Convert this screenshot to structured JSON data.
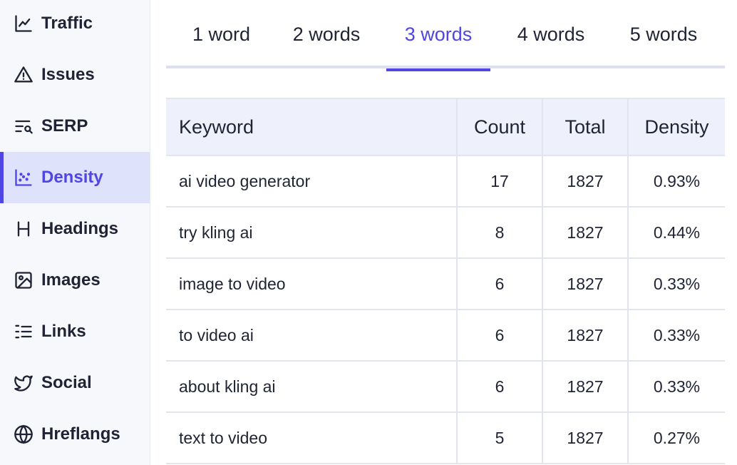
{
  "sidebar": {
    "items": [
      {
        "label": "Traffic",
        "icon": "chart-line-icon"
      },
      {
        "label": "Issues",
        "icon": "warning-icon"
      },
      {
        "label": "SERP",
        "icon": "serp-search-icon"
      },
      {
        "label": "Density",
        "icon": "scatter-chart-icon",
        "active": true
      },
      {
        "label": "Headings",
        "icon": "heading-icon"
      },
      {
        "label": "Images",
        "icon": "image-icon"
      },
      {
        "label": "Links",
        "icon": "list-icon"
      },
      {
        "label": "Social",
        "icon": "twitter-icon"
      },
      {
        "label": "Hreflangs",
        "icon": "globe-icon"
      }
    ]
  },
  "tabs": [
    "1 word",
    "2 words",
    "3 words",
    "4 words",
    "5 words"
  ],
  "active_tab": "3 words",
  "table": {
    "headers": {
      "keyword": "Keyword",
      "count": "Count",
      "total": "Total",
      "density": "Density"
    },
    "rows": [
      {
        "keyword": "ai video generator",
        "count": "17",
        "total": "1827",
        "density": "0.93%"
      },
      {
        "keyword": "try kling ai",
        "count": "8",
        "total": "1827",
        "density": "0.44%"
      },
      {
        "keyword": "image to video",
        "count": "6",
        "total": "1827",
        "density": "0.33%"
      },
      {
        "keyword": "to video ai",
        "count": "6",
        "total": "1827",
        "density": "0.33%"
      },
      {
        "keyword": "about kling ai",
        "count": "6",
        "total": "1827",
        "density": "0.33%"
      },
      {
        "keyword": "text to video",
        "count": "5",
        "total": "1827",
        "density": "0.27%"
      }
    ]
  },
  "colors": {
    "accent": "#4f46e5",
    "active_bg": "#dfe2fb",
    "header_bg": "#eef0fb"
  }
}
